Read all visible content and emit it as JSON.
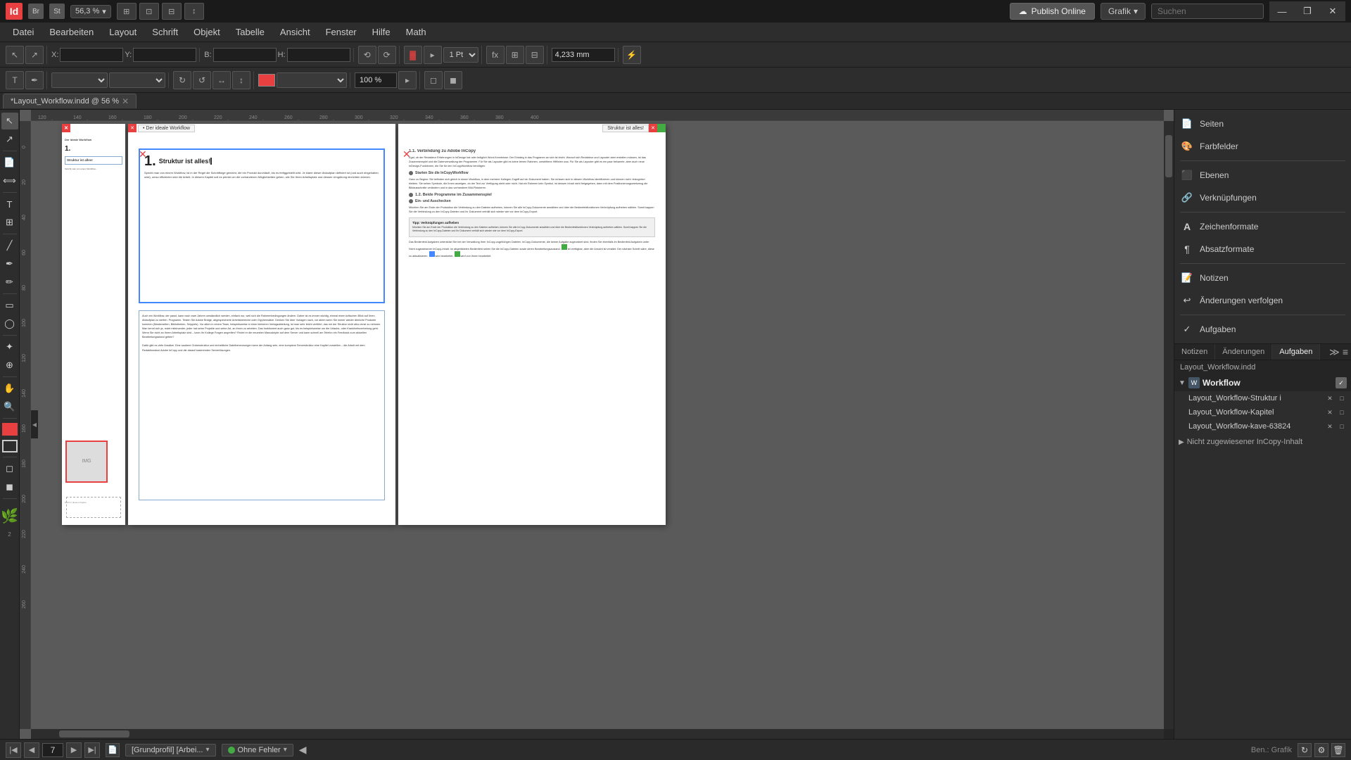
{
  "titlebar": {
    "app_name": "Id",
    "bridge_label": "Br",
    "stock_label": "St",
    "zoom": "56,3 %",
    "publish_label": "Publish Online",
    "grafik_label": "Grafik",
    "search_placeholder": "Suchen",
    "win_minimize": "—",
    "win_restore": "❐",
    "win_close": "✕"
  },
  "menubar": {
    "items": [
      "Datei",
      "Bearbeiten",
      "Layout",
      "Schrift",
      "Objekt",
      "Tabelle",
      "Ansicht",
      "Fenster",
      "Hilfe",
      "Math"
    ]
  },
  "toolbar": {
    "x_label": "X:",
    "y_label": "Y:",
    "b_label": "B:",
    "h_label": "H:",
    "dimension": "4,233 mm",
    "percent": "100 %",
    "stroke_size": "1 Pt"
  },
  "doctab": {
    "title": "*Layout_Workflow.indd @ 56 %",
    "close": "✕"
  },
  "ruler": {
    "ticks": [
      "120",
      "140",
      "160",
      "180",
      "200",
      "220",
      "240",
      "260",
      "280",
      "300",
      "320",
      "340",
      "360",
      "380",
      "400"
    ]
  },
  "pages": {
    "left_header": "Der ideale Workflow",
    "chapter_title": "1. Struktur ist alles!",
    "chapter_body_1": "Spricht man von einem Workflow, ist in der Regel die Schnittfolge gemeint, die ein Produkt durchläuft, bis es fertiggestellt wird. Je klarer dieser Ablaufplan definiert ist (und auch eingehalten wird), umso effizienter wird die Arbeit. In diesem Kapitel soll es primär um die vorhandenen Möglichkeiten gehen, wie Sie Ihren Arbeitsplatz und dessen Umgebung einrichten können.",
    "chapter_body_2": "Auch ein Workflow, der passt, kann nach zwei Jahren umständlich werden, einfach nur, weil sich die Rahmenbedingungen ändern. Daher ist es immer wichtig, einmal einen kritischen Blick auf Ihren Ablaufplan zu werfen. Programm. Testen Sie Adobe Bridge, abgespeicherte Arbeitsbereiche oder Glyphensätze. Denken Sie über Vorlagen nach, vor allem wenn Sie immer wieder ähnliche Produkte kommen (Musterseiten, Bibliotheken, Snippets). Vor allem in einem Team, beispielsweise in einer kleineren Verlagsabteilung, ist man sehr leicht verführt, das mir der Struktur nicht allzu ernst zu nehmen. Man kennt sich ja, redet miteinander, jeder hat seine Projekte und seine Art, an ihnen zu arbeiten. Das funktioniert auch ganz gut, bis es beispielsweise um die Urlaubs- oder Krankheitsvertretung geht. Wenn Sie nicht an Ihrem Arbeitsplatz sind – kann Ihr Kollege Fragen angreifen? Findet er die neuesten Manuskripte auf dem Server und kann schnell am Telefon ein Feedback zum aktuellen Bearbeitungsstand geben?",
    "right_title_1": "1.1. Verbindung zu Adobe InCopy",
    "right_body_1": "Egal, ob der Redakteur Erfahrungen in InDesign hat oder lediglich Word-Kenntnisse: Der Einstieg in das Programm an sich ist leicht. Worauf sich Redakteur und Layouter aber erstellen müssen, ist das Zusammenspiel und die Datenverwaltung der Programme. Für Sie als Layouter gibt es keine leeren Rahmen, umstrittene Hilflinien usw. Für Sie als Layouter gibt es ein paar bekannte, aber auch neue InDesign-Funktionen, die Sie für den InCopyWorkflow benötigen.",
    "right_sub_1": "Starten Sie die InCopyWorkflow",
    "right_body_2": "Ganz zu Beginn: Sie befinden sich gleich in einem Workflow, in dem mehrere Kollegen Zugriff auf ein Dokument haben. Sie müssen sich in diesem Workflow identifizieren und können nicht »inkognito« bleiben. Sie sehen Symbole, die Ihnen anzeigen, ob der Text zur Verfügung steht oder nicht. Hat ein Rahmen kein Symbol, ist dessen Inhalt nicht freigegeben, dann mit dem Positionierungswerkzeug die Bildausschnitte verändern und in das vorhandene Bild-Platzieren.",
    "right_sub_2": "1.2. Beide Programme im Zusammenspiel",
    "right_sub_3": "Ein- und Auschecken",
    "right_body_3": "Möchten Sie am Ende der Produktion die Verbindung zu den Dateien aufheben, können Sie alle InCopy-Dokumente anwählen und über die Bedienfeldfunktionen Verknüpfung aufheben wählen. Somit kappen Sie die Verbindung zu den InCopy-Dateien und Ihr Dokument verhält sich wieder wie vor dem InCopy-Export.",
    "tip_title": "Tipp: Verknüpfungen aufheben",
    "tip_body": "Möchten Sie am Ende der Produktion die Verbindung zu den Dateien aufheben, können Sie alle InCopy-Dokumente anwählen und über die Bedienfeldfunktionen Verknüpfung aufheben wählen. Somit kappen Sie die Verbindung zu den InCopy-Dateien und Ihr Dokument verhält sich wieder wie vor dem InCopy-Export.",
    "assign_body": "Das Bedienfeld Aufgaben unterstützt Sie bei der Verwaltung Ihrer InCopy-zuzugehörigen Dateien. InCopy-Dokumente, die keiner Aufgabe zugeordnet sind, finden Sie ebenfalls im Bedienfeld Aufgaben unter Nicht zugewiesener InCopy-Inhalt."
  },
  "right_panel": {
    "items": [
      {
        "icon": "📄",
        "label": "Seiten"
      },
      {
        "icon": "🎨",
        "label": "Farbfelder"
      },
      {
        "icon": "⬛",
        "label": "Ebenen"
      },
      {
        "icon": "🔗",
        "label": "Verknüpfungen"
      },
      {
        "icon": "A",
        "label": "Zeichenformate"
      },
      {
        "icon": "¶",
        "label": "Absatzformate"
      },
      {
        "icon": "📝",
        "label": "Notizen"
      },
      {
        "icon": "↩",
        "label": "Änderungen verfolgen"
      },
      {
        "icon": "✓",
        "label": "Aufgaben"
      }
    ]
  },
  "assignment_panel": {
    "tabs": [
      "Notizen",
      "Änderungen",
      "Aufgaben"
    ],
    "active_tab": "Aufgaben",
    "filename": "Layout_Workflow.indd",
    "group_name": "Workflow",
    "items": [
      {
        "name": "Layout_Workflow-Struktur i",
        "icon1": "✕",
        "icon2": "□"
      },
      {
        "name": "Layout_Workflow-Kapitel",
        "icon1": "✕",
        "icon2": "□"
      },
      {
        "name": "Layout_Workflow-kave-63824",
        "icon1": "✕",
        "icon2": "□"
      }
    ],
    "unassigned_label": "Nicht zugewiesener InCopy-Inhalt"
  },
  "statusbar": {
    "page_num": "7",
    "profile_label": "[Grundprofil] [Arbei...",
    "status_label": "Ohne Fehler",
    "ben_label": "Ben.: Grafik"
  }
}
